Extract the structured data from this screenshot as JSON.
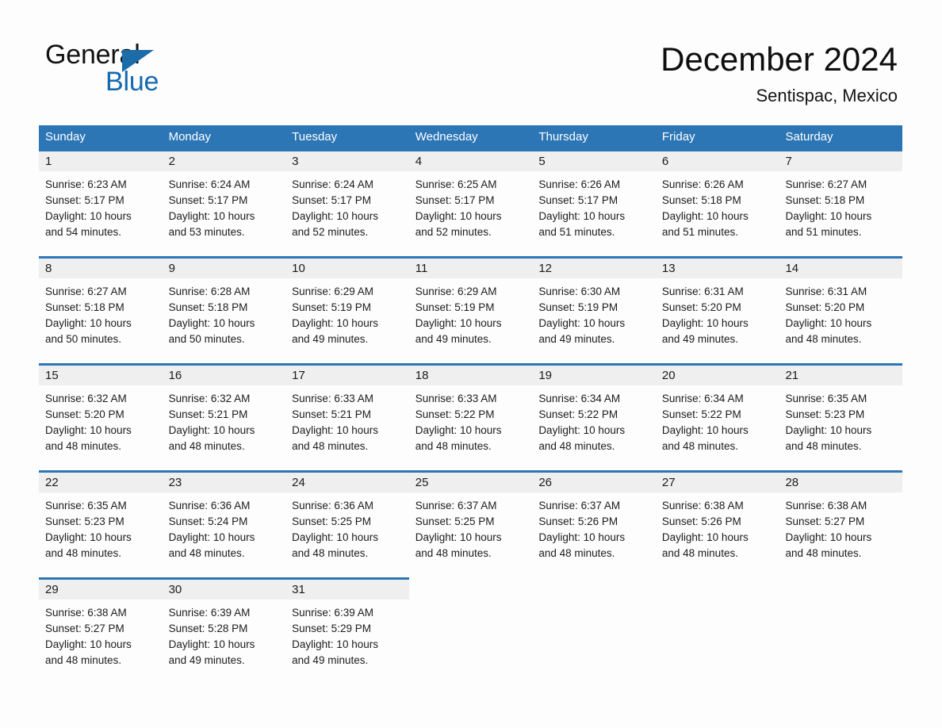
{
  "brand": {
    "word_one": "General",
    "word_two": "Blue",
    "triangle_icon": "brand-triangle-icon",
    "accent_color": "#1569b0"
  },
  "header": {
    "title": "December 2024",
    "subtitle": "Sentispac, Mexico"
  },
  "theme": {
    "header_row_bg": "#2d76b5",
    "daynum_bg": "#efefef",
    "page_bg": "#fdfdfd",
    "text_color": "#1a1a1a"
  },
  "calendar": {
    "weekdays": [
      "Sunday",
      "Monday",
      "Tuesday",
      "Wednesday",
      "Thursday",
      "Friday",
      "Saturday"
    ],
    "weeks": [
      [
        {
          "day": "1",
          "lines": [
            "Sunrise: 6:23 AM",
            "Sunset: 5:17 PM",
            "Daylight: 10 hours",
            "and 54 minutes."
          ]
        },
        {
          "day": "2",
          "lines": [
            "Sunrise: 6:24 AM",
            "Sunset: 5:17 PM",
            "Daylight: 10 hours",
            "and 53 minutes."
          ]
        },
        {
          "day": "3",
          "lines": [
            "Sunrise: 6:24 AM",
            "Sunset: 5:17 PM",
            "Daylight: 10 hours",
            "and 52 minutes."
          ]
        },
        {
          "day": "4",
          "lines": [
            "Sunrise: 6:25 AM",
            "Sunset: 5:17 PM",
            "Daylight: 10 hours",
            "and 52 minutes."
          ]
        },
        {
          "day": "5",
          "lines": [
            "Sunrise: 6:26 AM",
            "Sunset: 5:17 PM",
            "Daylight: 10 hours",
            "and 51 minutes."
          ]
        },
        {
          "day": "6",
          "lines": [
            "Sunrise: 6:26 AM",
            "Sunset: 5:18 PM",
            "Daylight: 10 hours",
            "and 51 minutes."
          ]
        },
        {
          "day": "7",
          "lines": [
            "Sunrise: 6:27 AM",
            "Sunset: 5:18 PM",
            "Daylight: 10 hours",
            "and 51 minutes."
          ]
        }
      ],
      [
        {
          "day": "8",
          "lines": [
            "Sunrise: 6:27 AM",
            "Sunset: 5:18 PM",
            "Daylight: 10 hours",
            "and 50 minutes."
          ]
        },
        {
          "day": "9",
          "lines": [
            "Sunrise: 6:28 AM",
            "Sunset: 5:18 PM",
            "Daylight: 10 hours",
            "and 50 minutes."
          ]
        },
        {
          "day": "10",
          "lines": [
            "Sunrise: 6:29 AM",
            "Sunset: 5:19 PM",
            "Daylight: 10 hours",
            "and 49 minutes."
          ]
        },
        {
          "day": "11",
          "lines": [
            "Sunrise: 6:29 AM",
            "Sunset: 5:19 PM",
            "Daylight: 10 hours",
            "and 49 minutes."
          ]
        },
        {
          "day": "12",
          "lines": [
            "Sunrise: 6:30 AM",
            "Sunset: 5:19 PM",
            "Daylight: 10 hours",
            "and 49 minutes."
          ]
        },
        {
          "day": "13",
          "lines": [
            "Sunrise: 6:31 AM",
            "Sunset: 5:20 PM",
            "Daylight: 10 hours",
            "and 49 minutes."
          ]
        },
        {
          "day": "14",
          "lines": [
            "Sunrise: 6:31 AM",
            "Sunset: 5:20 PM",
            "Daylight: 10 hours",
            "and 48 minutes."
          ]
        }
      ],
      [
        {
          "day": "15",
          "lines": [
            "Sunrise: 6:32 AM",
            "Sunset: 5:20 PM",
            "Daylight: 10 hours",
            "and 48 minutes."
          ]
        },
        {
          "day": "16",
          "lines": [
            "Sunrise: 6:32 AM",
            "Sunset: 5:21 PM",
            "Daylight: 10 hours",
            "and 48 minutes."
          ]
        },
        {
          "day": "17",
          "lines": [
            "Sunrise: 6:33 AM",
            "Sunset: 5:21 PM",
            "Daylight: 10 hours",
            "and 48 minutes."
          ]
        },
        {
          "day": "18",
          "lines": [
            "Sunrise: 6:33 AM",
            "Sunset: 5:22 PM",
            "Daylight: 10 hours",
            "and 48 minutes."
          ]
        },
        {
          "day": "19",
          "lines": [
            "Sunrise: 6:34 AM",
            "Sunset: 5:22 PM",
            "Daylight: 10 hours",
            "and 48 minutes."
          ]
        },
        {
          "day": "20",
          "lines": [
            "Sunrise: 6:34 AM",
            "Sunset: 5:22 PM",
            "Daylight: 10 hours",
            "and 48 minutes."
          ]
        },
        {
          "day": "21",
          "lines": [
            "Sunrise: 6:35 AM",
            "Sunset: 5:23 PM",
            "Daylight: 10 hours",
            "and 48 minutes."
          ]
        }
      ],
      [
        {
          "day": "22",
          "lines": [
            "Sunrise: 6:35 AM",
            "Sunset: 5:23 PM",
            "Daylight: 10 hours",
            "and 48 minutes."
          ]
        },
        {
          "day": "23",
          "lines": [
            "Sunrise: 6:36 AM",
            "Sunset: 5:24 PM",
            "Daylight: 10 hours",
            "and 48 minutes."
          ]
        },
        {
          "day": "24",
          "lines": [
            "Sunrise: 6:36 AM",
            "Sunset: 5:25 PM",
            "Daylight: 10 hours",
            "and 48 minutes."
          ]
        },
        {
          "day": "25",
          "lines": [
            "Sunrise: 6:37 AM",
            "Sunset: 5:25 PM",
            "Daylight: 10 hours",
            "and 48 minutes."
          ]
        },
        {
          "day": "26",
          "lines": [
            "Sunrise: 6:37 AM",
            "Sunset: 5:26 PM",
            "Daylight: 10 hours",
            "and 48 minutes."
          ]
        },
        {
          "day": "27",
          "lines": [
            "Sunrise: 6:38 AM",
            "Sunset: 5:26 PM",
            "Daylight: 10 hours",
            "and 48 minutes."
          ]
        },
        {
          "day": "28",
          "lines": [
            "Sunrise: 6:38 AM",
            "Sunset: 5:27 PM",
            "Daylight: 10 hours",
            "and 48 minutes."
          ]
        }
      ],
      [
        {
          "day": "29",
          "lines": [
            "Sunrise: 6:38 AM",
            "Sunset: 5:27 PM",
            "Daylight: 10 hours",
            "and 48 minutes."
          ]
        },
        {
          "day": "30",
          "lines": [
            "Sunrise: 6:39 AM",
            "Sunset: 5:28 PM",
            "Daylight: 10 hours",
            "and 49 minutes."
          ]
        },
        {
          "day": "31",
          "lines": [
            "Sunrise: 6:39 AM",
            "Sunset: 5:29 PM",
            "Daylight: 10 hours",
            "and 49 minutes."
          ]
        },
        {
          "day": "",
          "lines": []
        },
        {
          "day": "",
          "lines": []
        },
        {
          "day": "",
          "lines": []
        },
        {
          "day": "",
          "lines": []
        }
      ]
    ]
  }
}
